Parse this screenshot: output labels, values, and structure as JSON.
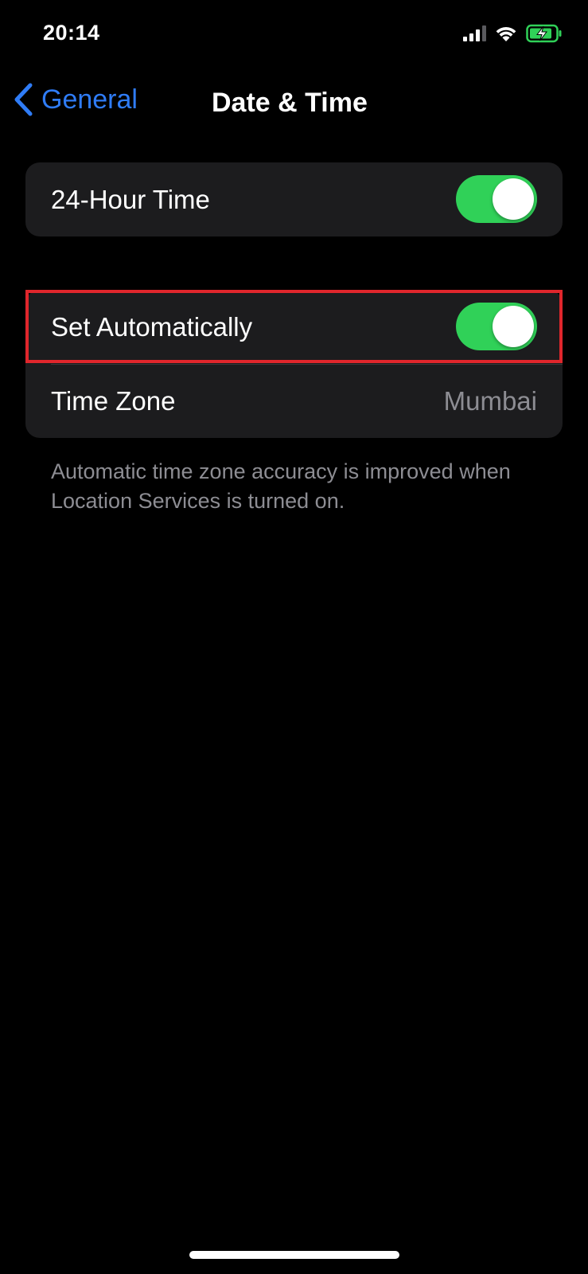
{
  "status_bar": {
    "time": "20:14",
    "icons": [
      "cellular-signal-icon",
      "wifi-icon",
      "battery-charging-icon"
    ],
    "battery_color": "#30d158"
  },
  "nav": {
    "back_label": "General",
    "title": "Date & Time",
    "back_color": "#2f7cf6"
  },
  "group1": {
    "rows": [
      {
        "label": "24-Hour Time",
        "toggle_on": true
      }
    ]
  },
  "group2": {
    "rows": [
      {
        "label": "Set Automatically",
        "toggle_on": true
      },
      {
        "label": "Time Zone",
        "value": "Mumbai"
      }
    ]
  },
  "footnote": "Automatic time zone accuracy is improved when Location Services is turned on.",
  "colors": {
    "toggle_on": "#30d158",
    "highlight": "#e0262c",
    "group_bg": "#1c1c1e"
  }
}
